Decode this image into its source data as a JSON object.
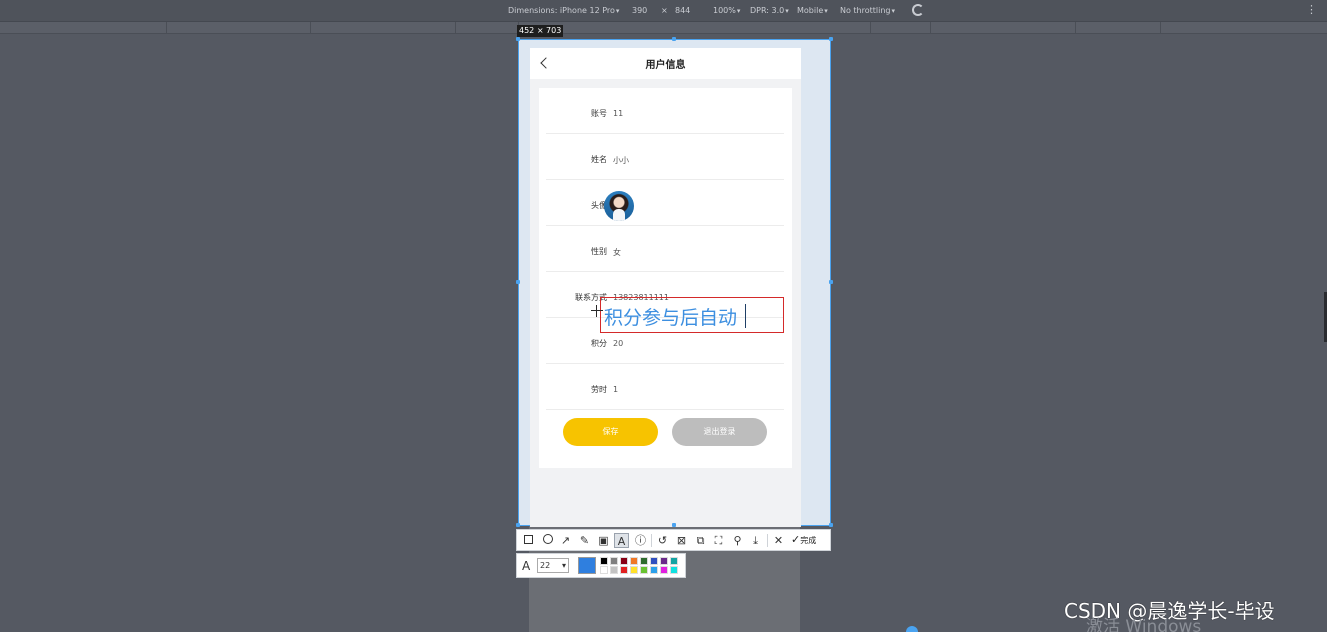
{
  "devtools": {
    "dimensions_label": "Dimensions: iPhone 12 Pro",
    "width": "390",
    "times": "×",
    "height": "844",
    "zoom": "100%",
    "dpr": "DPR: 3.0",
    "mobile": "Mobile",
    "throttling": "No throttling",
    "kebab": "⋮",
    "viewport_size": "452 × 703"
  },
  "page": {
    "title": "用户信息",
    "rows": [
      {
        "label": "账号",
        "value": "11"
      },
      {
        "label": "姓名",
        "value": "小小"
      },
      {
        "label": "头像",
        "value": ""
      },
      {
        "label": "性别",
        "value": "女"
      },
      {
        "label": "联系方式",
        "value": "13823811111"
      },
      {
        "label": "积分",
        "value": "20"
      },
      {
        "label": "劳时",
        "value": "1"
      }
    ],
    "save_label": "保存",
    "logout_label": "退出登录"
  },
  "annotation": {
    "text": "积分参与后自动",
    "text_color": "#3d8fe0",
    "box_color": "#d42a2a"
  },
  "screenshot_toolbar": {
    "tools": [
      "rectangle-icon",
      "ellipse-icon",
      "arrow-icon",
      "pen-icon",
      "mosaic-icon",
      "text-icon",
      "number-icon",
      "undo-icon",
      "save-icon",
      "copy-icon",
      "fullscreen-icon",
      "pin-icon",
      "download-icon",
      "close-icon"
    ],
    "done_label": "完成",
    "font_size": "22",
    "current_color": "#2f7fdf",
    "swatches": [
      "#000000",
      "#7f7f7f",
      "#880015",
      "#f07828",
      "#2e6b2e",
      "#2f4fbf",
      "#6a2a8a",
      "#14a3a3",
      "#ffffff",
      "#c3c3c3",
      "#e02020",
      "#ffe02a",
      "#68c230",
      "#2aa0ea",
      "#e020e0",
      "#10e0e0"
    ]
  },
  "watermark": {
    "csdn": "CSDN @晨逸学长-毕设",
    "windows": "激活 Windows"
  }
}
